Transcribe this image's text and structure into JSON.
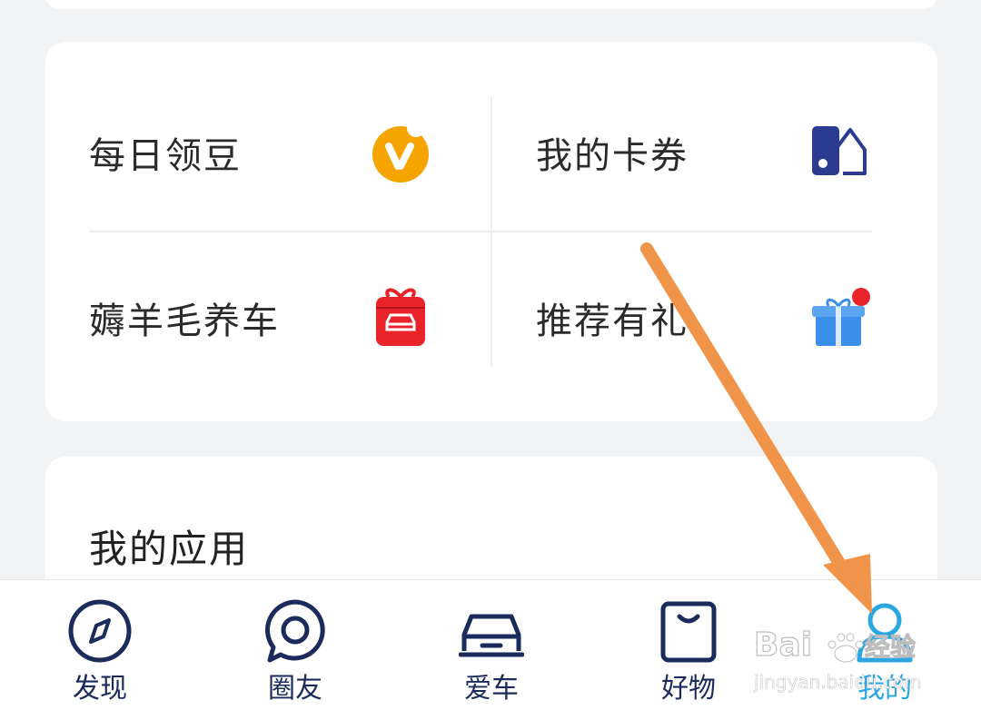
{
  "cards": {
    "quick_links": [
      {
        "label": "每日领豆",
        "icon": "daily-beans-icon"
      },
      {
        "label": "我的卡券",
        "icon": "coupon-icon"
      },
      {
        "label": "薅羊毛养车",
        "icon": "car-gift-icon"
      },
      {
        "label": "推荐有礼",
        "icon": "gift-box-icon"
      }
    ],
    "apps_title": "我的应用"
  },
  "tabbar": {
    "tabs": [
      {
        "label": "发现",
        "icon": "compass-icon"
      },
      {
        "label": "圈友",
        "icon": "chat-bubble-icon"
      },
      {
        "label": "爱车",
        "icon": "car-icon"
      },
      {
        "label": "好物",
        "icon": "bag-icon"
      },
      {
        "label": "我的",
        "icon": "profile-icon",
        "active": true
      }
    ]
  },
  "colors": {
    "navy": "#1a2b5c",
    "active": "#2aa6e2",
    "orange_icon": "#f5a400",
    "red_icon": "#e8232a",
    "blue_icon": "#3b8fe8",
    "arrow": "#f0944a"
  },
  "watermark": {
    "brand_text": "Bai",
    "brand_cn": "经验",
    "url": "jingyan.baidu.com"
  }
}
